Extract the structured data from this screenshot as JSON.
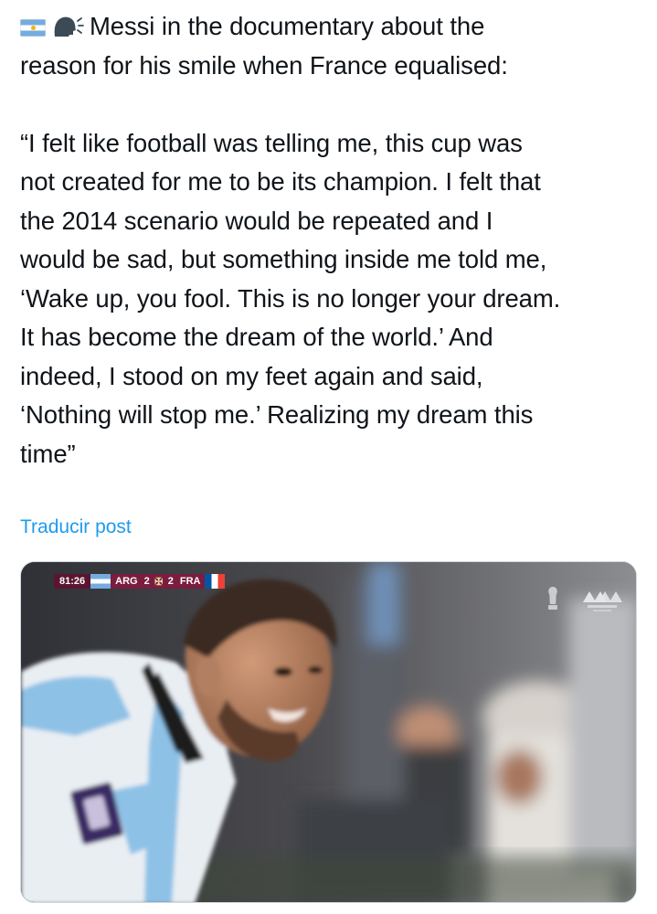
{
  "post": {
    "icons": [
      "argentina-flag-icon",
      "speaking-head-icon"
    ],
    "colors": {
      "text": "#0f1419",
      "link": "#1d9bf0",
      "border": "#cfd9de"
    },
    "lines": [
      "Messi in the documentary about the",
      "reason for his smile when France equalised:",
      "",
      "“I felt like football was telling me, this cup was",
      "not created for me to be its champion. I felt that",
      "the 2014 scenario would be repeated and I",
      "would be sad, but something inside me told me,",
      "‘Wake up, you fool. This is no longer your dream.",
      "It has become the dream of the world.’ And",
      "indeed, I stood on my feet again and said,",
      "‘Nothing will stop me.’ Realizing my dream this",
      "time”"
    ],
    "translate_label": "Traducir post"
  },
  "media": {
    "scoreboard": {
      "clock": "81:26",
      "home_team": "ARG",
      "home_score": "2",
      "away_score": "2",
      "away_team": "FRA"
    }
  }
}
